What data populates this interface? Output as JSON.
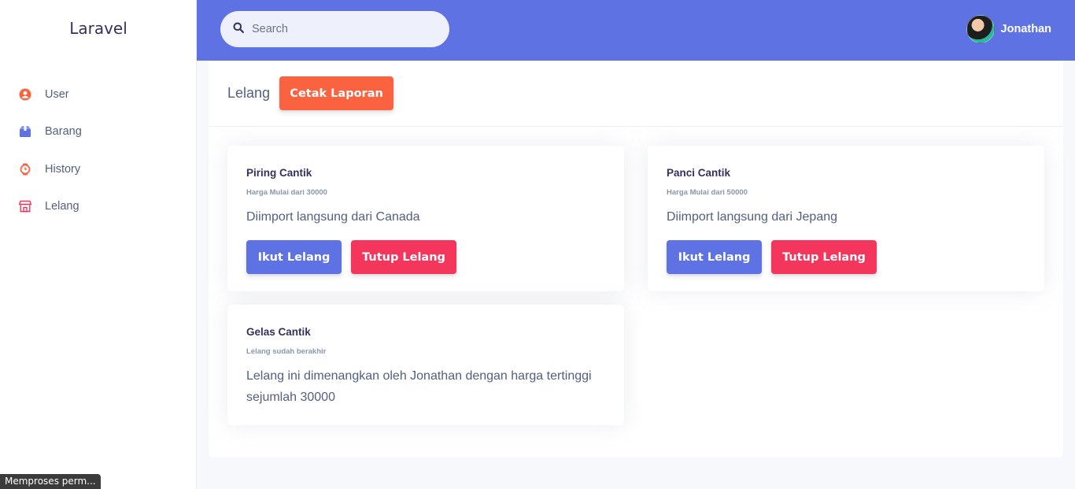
{
  "sidebar": {
    "brand": "Laravel",
    "items": [
      {
        "label": "User",
        "icon": "user-circle-icon",
        "color": "#fb6340"
      },
      {
        "label": "Barang",
        "icon": "box-icon",
        "color": "#5e72e4"
      },
      {
        "label": "History",
        "icon": "watch-icon",
        "color": "#fb6340"
      },
      {
        "label": "Lelang",
        "icon": "shop-icon",
        "color": "#f5365c"
      }
    ]
  },
  "topbar": {
    "search_placeholder": "Search",
    "user_name": "Jonathan",
    "color": "#5e72e4"
  },
  "panel": {
    "title": "Lelang",
    "print_button": "Cetak Laporan"
  },
  "cards": [
    {
      "title": "Piring Cantik",
      "subtitle": "Harga Mulai dari 30000",
      "text": "Diimport langsung dari Canada",
      "join_button": "Ikut Lelang",
      "close_button": "Tutup Lelang"
    },
    {
      "title": "Panci Cantik",
      "subtitle": "Harga Mulai dari 50000",
      "text": "Diimport langsung dari Jepang",
      "join_button": "Ikut Lelang",
      "close_button": "Tutup Lelang"
    },
    {
      "title": "Gelas Cantik",
      "subtitle": "Lelang sudah berakhir",
      "text_line1": "Lelang ini dimenangkan oleh Jonathan dengan harga tertinggi",
      "text_line2": "sejumlah 30000"
    }
  ],
  "status_bar": "Memproses perm..."
}
